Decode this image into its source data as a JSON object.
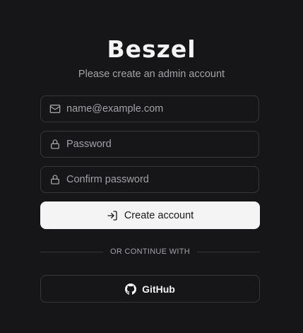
{
  "brand": {
    "logo_text": "Beszel"
  },
  "form": {
    "subtitle": "Please create an admin account",
    "email": {
      "placeholder": "name@example.com",
      "value": "",
      "icon": "mail-icon"
    },
    "password": {
      "placeholder": "Password",
      "value": "",
      "icon": "lock-icon"
    },
    "confirm_password": {
      "placeholder": "Confirm password",
      "value": "",
      "icon": "lock-icon"
    },
    "submit": {
      "label": "Create account",
      "icon": "log-in-icon"
    }
  },
  "divider": {
    "label": "OR CONTINUE WITH"
  },
  "oauth": {
    "github": {
      "label": "GitHub",
      "icon": "github-icon"
    }
  },
  "colors": {
    "background": "#161618",
    "border": "#37373b",
    "primary_button_bg": "#f4f4f5",
    "primary_button_text": "#18181b",
    "muted_text": "#a3a3a8"
  }
}
